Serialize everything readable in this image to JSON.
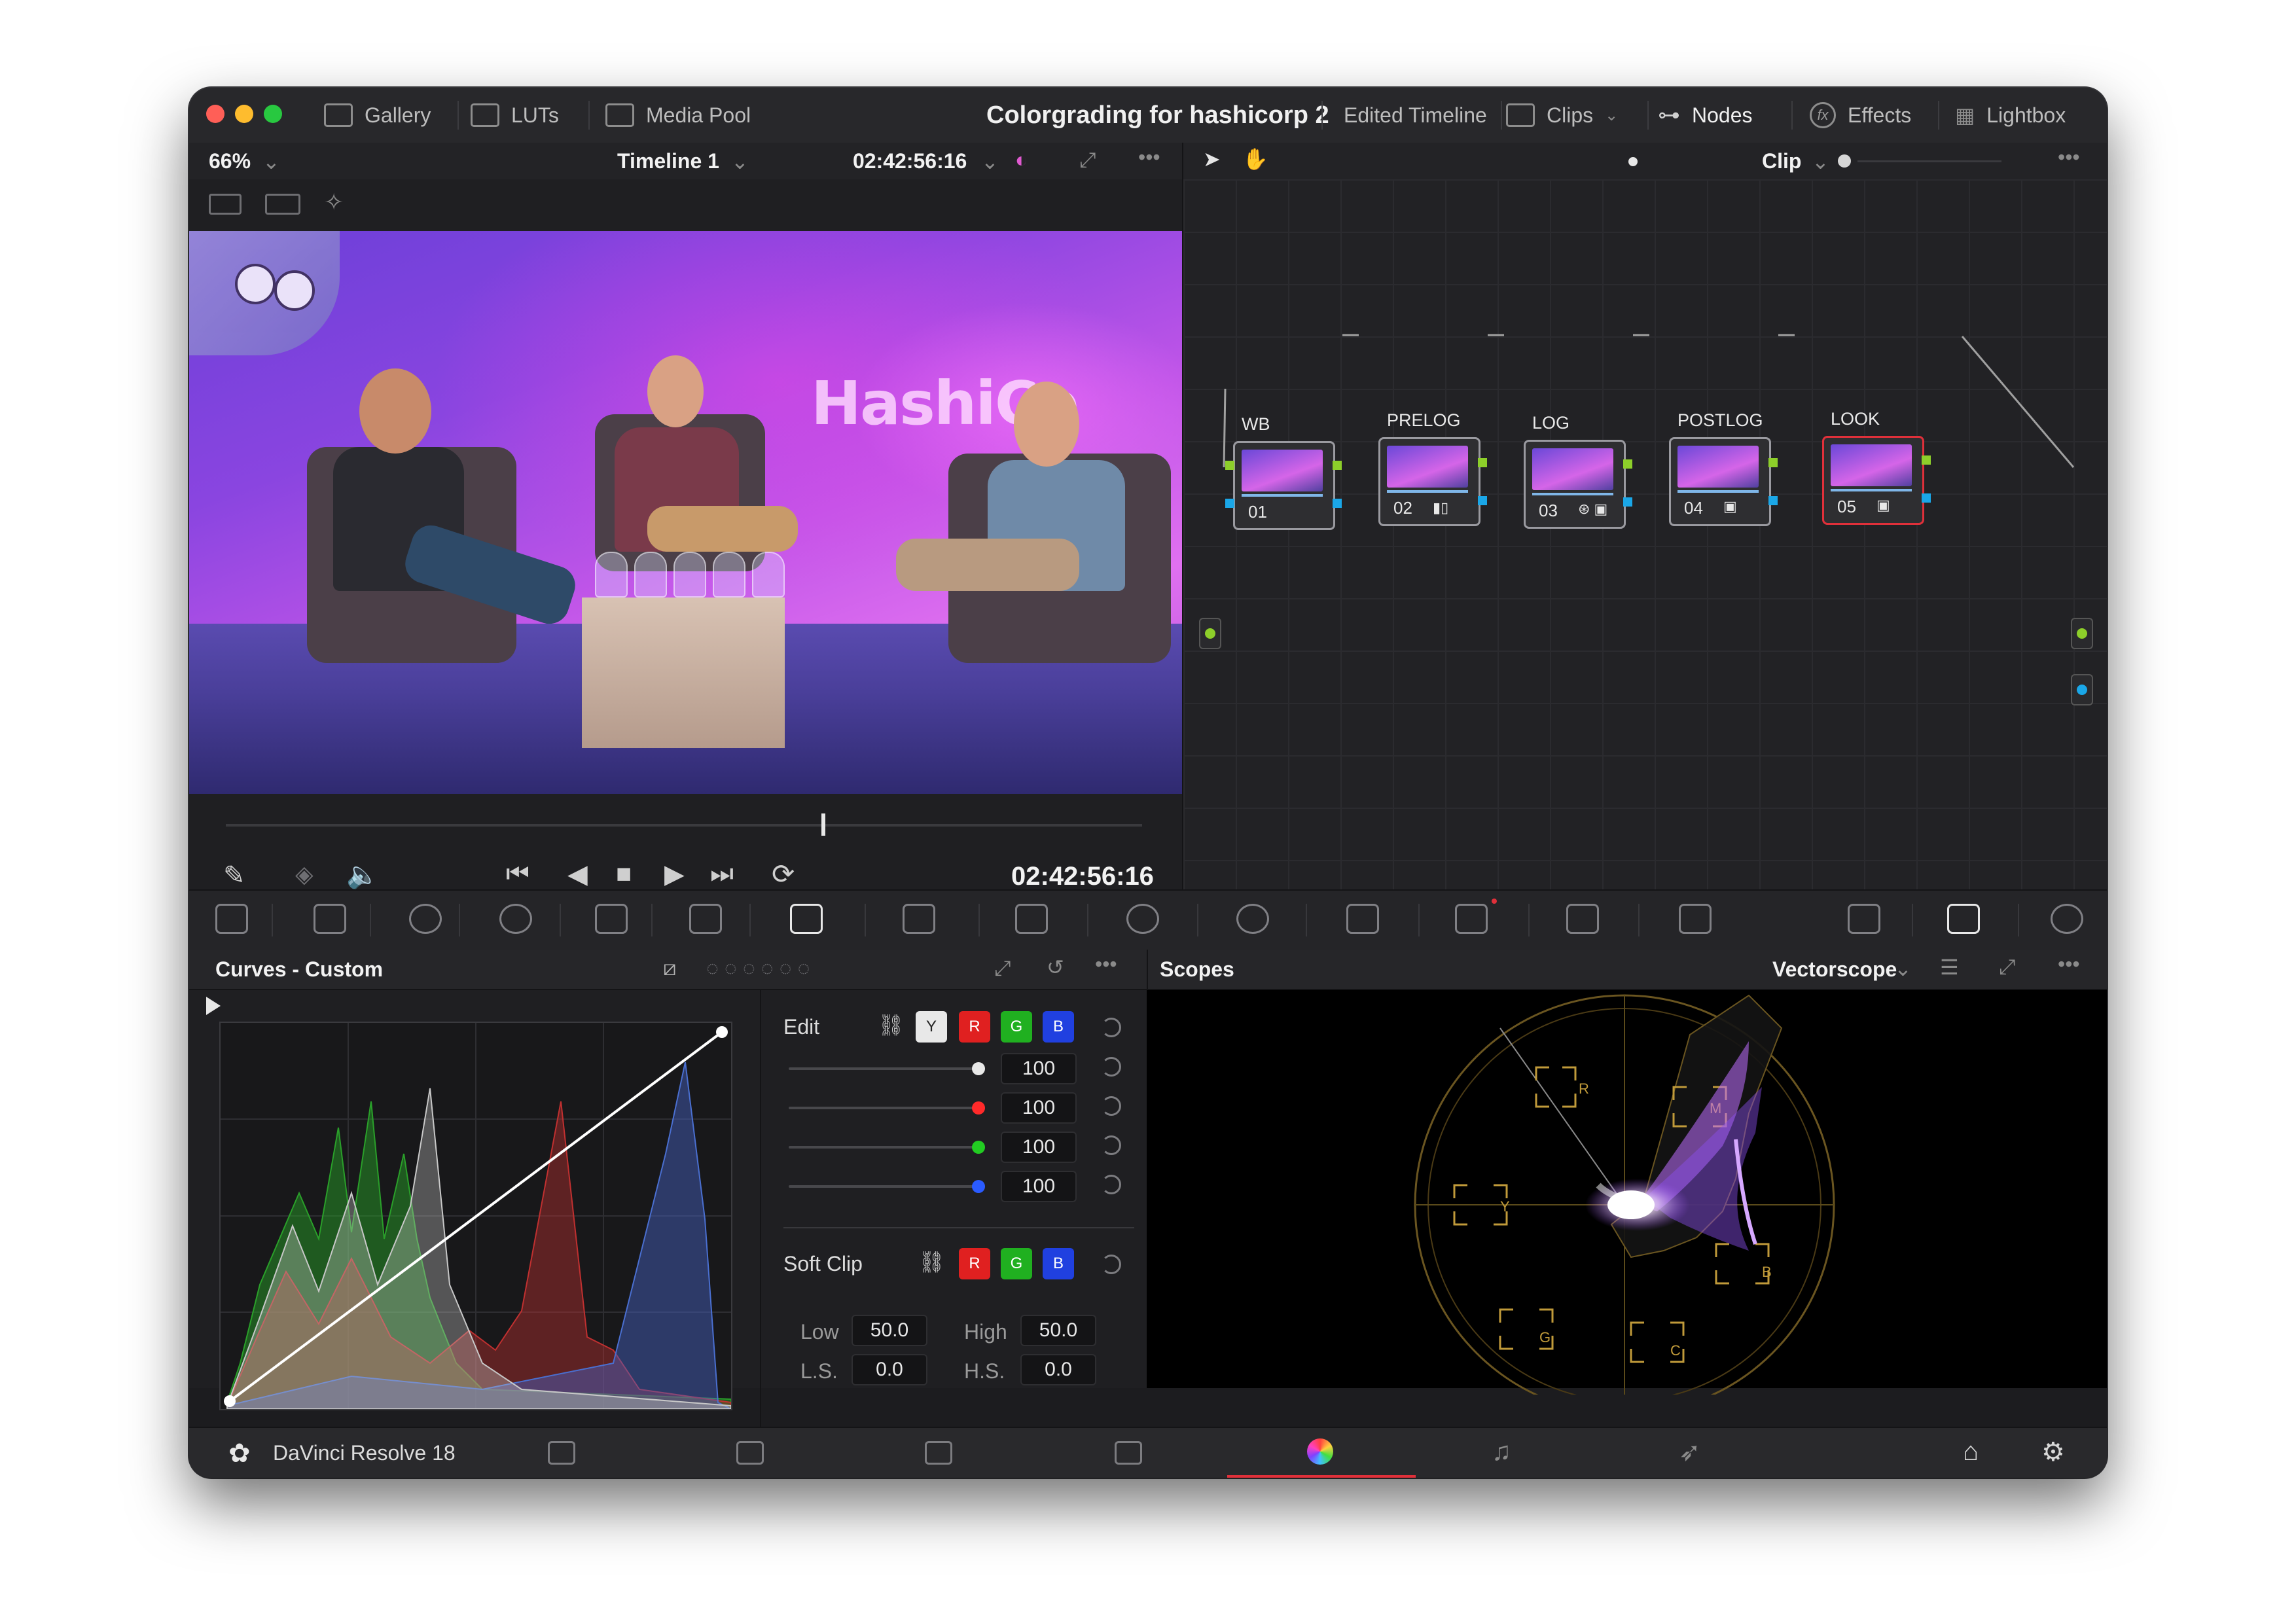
{
  "window": {
    "title": "Colorgrading for hashicorp 2",
    "traffic_lights": [
      "#ff5f57",
      "#febc2e",
      "#28c840"
    ]
  },
  "topbar": {
    "left": [
      {
        "label": "Gallery",
        "icon": "gallery-icon"
      },
      {
        "label": "LUTs",
        "icon": "luts-icon"
      },
      {
        "label": "Media Pool",
        "icon": "media-pool-icon"
      }
    ],
    "right": [
      {
        "label": "Edited Timeline",
        "icon": "timeline-icon"
      },
      {
        "label": "Clips",
        "icon": "clips-icon"
      },
      {
        "label": "Nodes",
        "icon": "nodes-icon"
      },
      {
        "label": "Effects",
        "icon": "effects-icon"
      },
      {
        "label": "Lightbox",
        "icon": "lightbox-icon"
      }
    ]
  },
  "viewer_bar": {
    "zoom": "66%",
    "timeline": "Timeline 1",
    "timecode": "02:42:56:16",
    "clip_mode": "Clip"
  },
  "viewer": {
    "watermark": "HashiCo",
    "playhead_fraction": 0.65
  },
  "transport": {
    "timecode": "02:42:56:16"
  },
  "nodes": [
    {
      "label": "WB",
      "number": "01",
      "active": false
    },
    {
      "label": "PRELOG",
      "number": "02",
      "active": false
    },
    {
      "label": "LOG",
      "number": "03",
      "active": false
    },
    {
      "label": "POSTLOG",
      "number": "04",
      "active": false
    },
    {
      "label": "LOOK",
      "number": "05",
      "active": true
    }
  ],
  "curves": {
    "title": "Curves - Custom",
    "edit_label": "Edit",
    "channels": [
      "Y",
      "R",
      "G",
      "B"
    ],
    "intensity": [
      {
        "value": "100",
        "color": "#ffffff"
      },
      {
        "value": "100",
        "color": "#ff2a2a"
      },
      {
        "value": "100",
        "color": "#22cc22"
      },
      {
        "value": "100",
        "color": "#2a5bff"
      }
    ],
    "soft_clip_label": "Soft Clip",
    "soft_clip_channels": [
      "R",
      "G",
      "B"
    ],
    "low_label": "Low",
    "low": "50.0",
    "high_label": "High",
    "high": "50.0",
    "ls_label": "L.S.",
    "ls": "0.0",
    "hs_label": "H.S.",
    "hs": "0.0"
  },
  "scopes": {
    "title": "Scopes",
    "mode": "Vectorscope",
    "targets": [
      "R",
      "M",
      "B",
      "C",
      "G",
      "Y"
    ]
  },
  "bottombar": {
    "app_name": "DaVinci Resolve 18",
    "pages": [
      "media",
      "cut",
      "edit",
      "fusion",
      "color",
      "fairlight",
      "deliver"
    ],
    "active_page": "color"
  }
}
